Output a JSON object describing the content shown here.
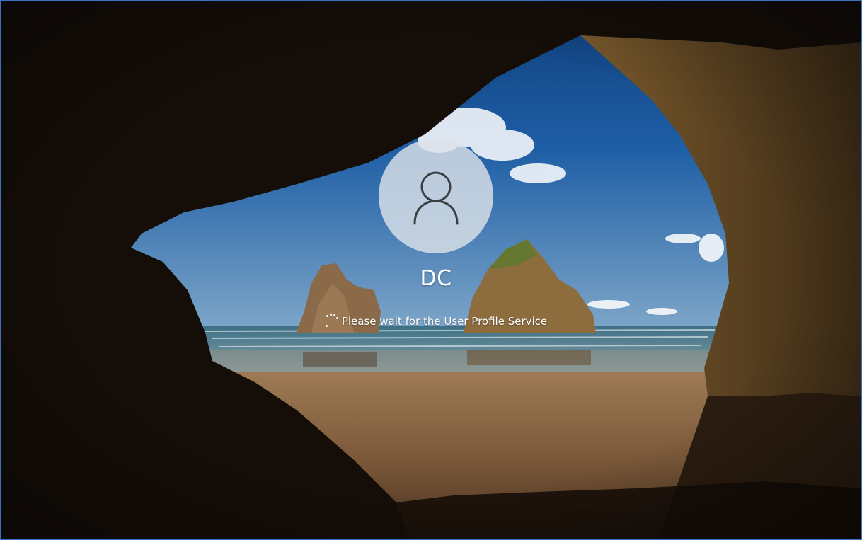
{
  "lock_screen": {
    "background": "cave-beach-wallpaper",
    "accent_color": "#3b6fc2"
  },
  "user": {
    "name": "DC",
    "avatar_icon": "user-icon"
  },
  "status": {
    "message": "Please wait for the User Profile Service",
    "indicator_icon": "loading-spinner-icon"
  }
}
